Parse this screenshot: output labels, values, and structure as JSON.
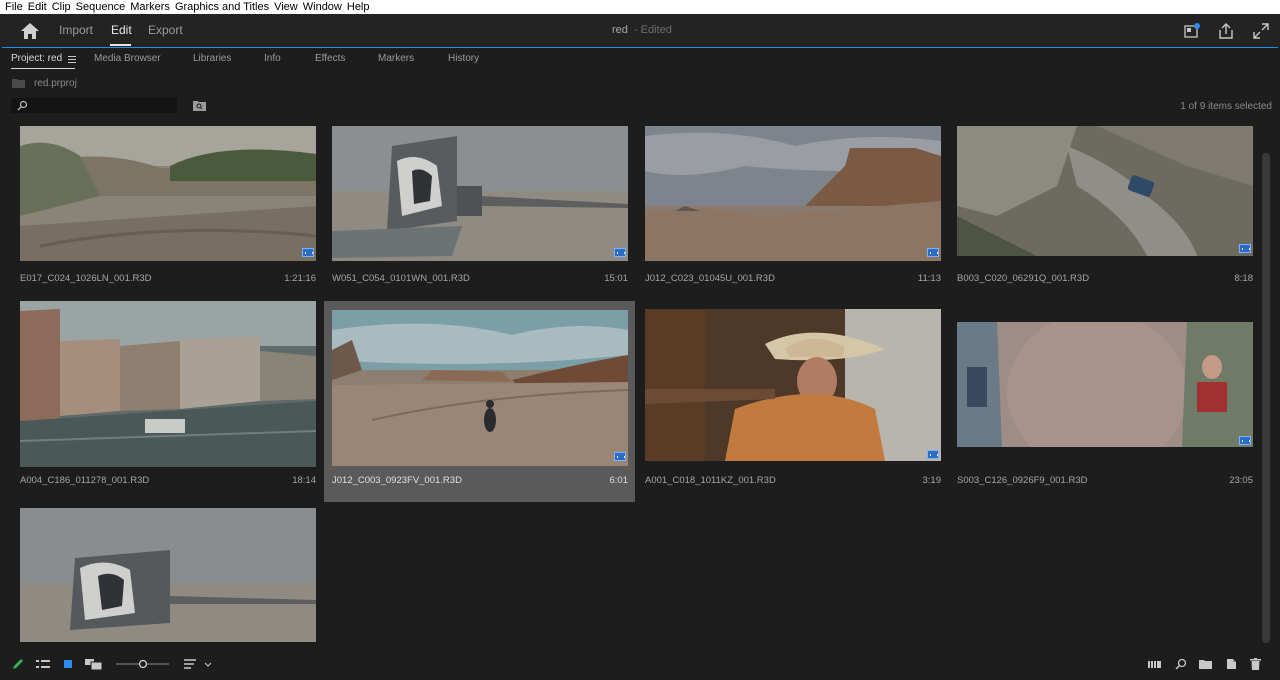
{
  "menu": [
    "File",
    "Edit",
    "Clip",
    "Sequence",
    "Markers",
    "Graphics and Titles",
    "View",
    "Window",
    "Help"
  ],
  "header": {
    "workspaces": [
      {
        "label": "Import",
        "active": false
      },
      {
        "label": "Edit",
        "active": true
      },
      {
        "label": "Export",
        "active": false
      }
    ],
    "doc_name": "red",
    "doc_status": "- Edited",
    "accent_color": "#2d8ceb"
  },
  "panel": {
    "tabs": [
      {
        "label": "Project: red",
        "active": true
      },
      {
        "label": "Media Browser",
        "active": false
      },
      {
        "label": "Libraries",
        "active": false
      },
      {
        "label": "Info",
        "active": false
      },
      {
        "label": "Effects",
        "active": false
      },
      {
        "label": "Markers",
        "active": false
      },
      {
        "label": "History",
        "active": false
      }
    ],
    "bin_name": "red.prproj",
    "search": {
      "value": "",
      "placeholder": ""
    },
    "selection_status": "1 of 9 items selected"
  },
  "clips": [
    {
      "name": "E017_C024_1026LN_001.R3D",
      "duration": "1:21:16",
      "selected": false
    },
    {
      "name": "W051_C054_0101WN_001.R3D",
      "duration": "15:01",
      "selected": false
    },
    {
      "name": "J012_C023_01045U_001.R3D",
      "duration": "11:13",
      "selected": false
    },
    {
      "name": "B003_C020_06291Q_001.R3D",
      "duration": "8:18",
      "selected": false
    },
    {
      "name": "A004_C186_011278_001.R3D",
      "duration": "18:14",
      "selected": false
    },
    {
      "name": "J012_C003_0923FV_001.R3D",
      "duration": "6:01",
      "selected": true
    },
    {
      "name": "A001_C018_1011KZ_001.R3D",
      "duration": "3:19",
      "selected": false
    },
    {
      "name": "S003_C126_0926F9_001.R3D",
      "duration": "23:05",
      "selected": false
    },
    {
      "name": "",
      "duration": "",
      "selected": false
    }
  ],
  "toolbar_icons": [
    "pencil-icon",
    "list-view-icon",
    "icon-view-icon",
    "freeform-view-icon",
    "zoom-slider",
    "sort-icon",
    "automate-to-sequence-icon",
    "find-icon",
    "new-bin-icon",
    "new-item-icon",
    "trash-icon"
  ]
}
